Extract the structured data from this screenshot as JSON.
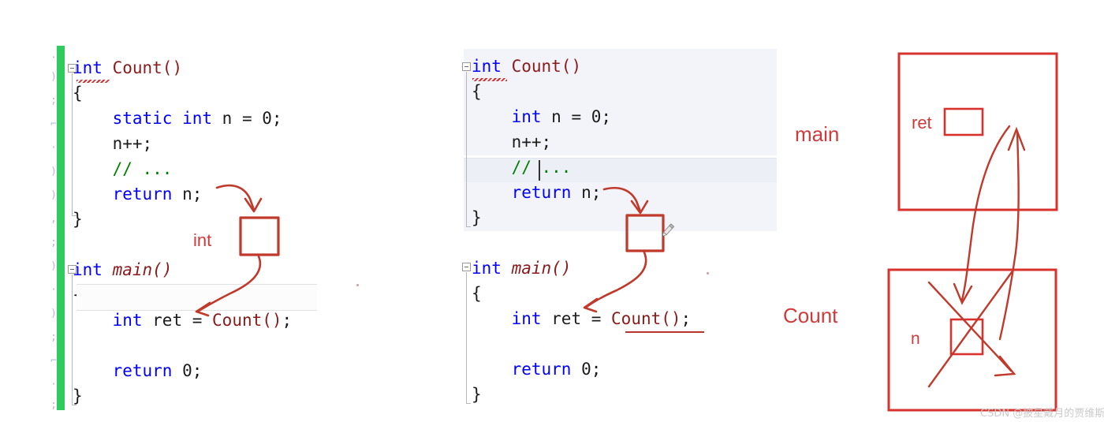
{
  "left_panel": {
    "name": "static-version-code",
    "lines": [
      {
        "indent": 0,
        "tokens": [
          {
            "t": "int",
            "c": "type"
          },
          {
            "t": " ",
            "c": "plain"
          },
          {
            "t": "Count()",
            "c": "fn"
          }
        ]
      },
      {
        "indent": 0,
        "tokens": [
          {
            "t": "{",
            "c": "plain"
          }
        ]
      },
      {
        "indent": 1,
        "tokens": [
          {
            "t": "static",
            "c": "kw"
          },
          {
            "t": " ",
            "c": "plain"
          },
          {
            "t": "int",
            "c": "kw"
          },
          {
            "t": " n = 0;",
            "c": "plain"
          }
        ]
      },
      {
        "indent": 1,
        "tokens": [
          {
            "t": "n++;",
            "c": "plain"
          }
        ]
      },
      {
        "indent": 1,
        "tokens": [
          {
            "t": "// ...",
            "c": "cmt"
          }
        ]
      },
      {
        "indent": 1,
        "tokens": [
          {
            "t": "return",
            "c": "kw"
          },
          {
            "t": " n;",
            "c": "plain"
          }
        ]
      },
      {
        "indent": 0,
        "tokens": [
          {
            "t": "}",
            "c": "plain"
          }
        ]
      },
      {
        "indent": 0,
        "tokens": []
      },
      {
        "indent": 0,
        "tokens": [
          {
            "t": "int",
            "c": "type"
          },
          {
            "t": " ",
            "c": "plain"
          },
          {
            "t": "main()",
            "c": "fn ital"
          }
        ]
      },
      {
        "indent": 0,
        "tokens": [
          {
            "t": "{",
            "c": "plain"
          }
        ]
      },
      {
        "indent": 1,
        "tokens": [
          {
            "t": "int",
            "c": "kw"
          },
          {
            "t": " ret = ",
            "c": "plain"
          },
          {
            "t": "Count()",
            "c": "fn"
          },
          {
            "t": ";",
            "c": "plain"
          }
        ]
      },
      {
        "indent": 1,
        "tokens": []
      },
      {
        "indent": 1,
        "tokens": [
          {
            "t": "return",
            "c": "kw"
          },
          {
            "t": " 0;",
            "c": "plain"
          }
        ]
      },
      {
        "indent": 0,
        "tokens": [
          {
            "t": "}",
            "c": "plain"
          }
        ]
      }
    ],
    "annotation_label": "int"
  },
  "middle_panel": {
    "name": "non-static-version-code",
    "lines": [
      {
        "indent": 0,
        "tokens": [
          {
            "t": "int",
            "c": "type"
          },
          {
            "t": " ",
            "c": "plain"
          },
          {
            "t": "Count()",
            "c": "fn"
          }
        ]
      },
      {
        "indent": 0,
        "tokens": [
          {
            "t": "{",
            "c": "plain"
          }
        ]
      },
      {
        "indent": 1,
        "tokens": [
          {
            "t": "int",
            "c": "kw"
          },
          {
            "t": " n = 0;",
            "c": "plain"
          }
        ]
      },
      {
        "indent": 1,
        "tokens": [
          {
            "t": "n++;",
            "c": "plain"
          }
        ]
      },
      {
        "indent": 1,
        "tokens": [
          {
            "t": "// ...",
            "c": "cmt"
          }
        ]
      },
      {
        "indent": 1,
        "tokens": [
          {
            "t": "return",
            "c": "kw"
          },
          {
            "t": " n;",
            "c": "plain"
          }
        ]
      },
      {
        "indent": 0,
        "tokens": [
          {
            "t": "}",
            "c": "plain"
          }
        ]
      },
      {
        "indent": 0,
        "tokens": []
      },
      {
        "indent": 0,
        "tokens": [
          {
            "t": "int",
            "c": "type"
          },
          {
            "t": " ",
            "c": "plain"
          },
          {
            "t": "main()",
            "c": "fn ital"
          }
        ]
      },
      {
        "indent": 0,
        "tokens": [
          {
            "t": "{",
            "c": "plain"
          }
        ]
      },
      {
        "indent": 1,
        "tokens": [
          {
            "t": "int",
            "c": "kw"
          },
          {
            "t": " ret = ",
            "c": "plain"
          },
          {
            "t": "Count()",
            "c": "fn"
          },
          {
            "t": ";",
            "c": "plain"
          }
        ]
      },
      {
        "indent": 1,
        "tokens": []
      },
      {
        "indent": 1,
        "tokens": [
          {
            "t": "return",
            "c": "kw"
          },
          {
            "t": " 0;",
            "c": "plain"
          }
        ]
      },
      {
        "indent": 0,
        "tokens": [
          {
            "t": "}",
            "c": "plain"
          }
        ]
      }
    ]
  },
  "diagram": {
    "main_label": "main",
    "main_var_label": "ret",
    "count_label": "Count",
    "count_var_label": "n"
  },
  "colors": {
    "keyword": "#0000ff",
    "function": "#8b1a1a",
    "comment": "#008000",
    "ink_red": "#cf3b3b",
    "box_red": "#d32f2f",
    "change_bar_green": "#2ecb5e",
    "highlight_bg": "#f2f4f9"
  },
  "watermark": "CSDN @披星戴月的贾维斯"
}
